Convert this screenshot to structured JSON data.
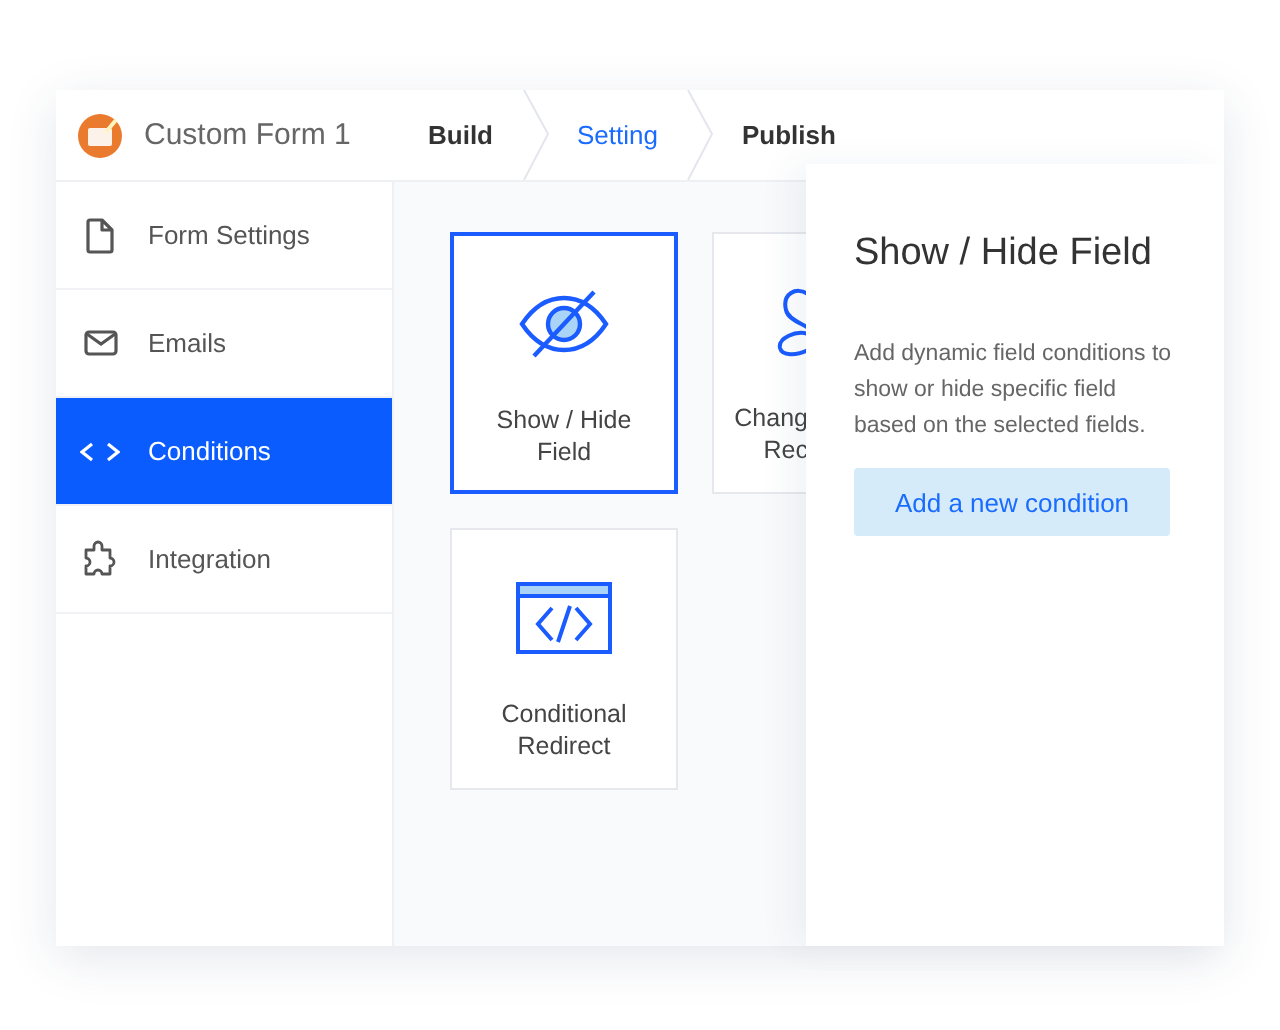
{
  "app": {
    "form_title": "Custom Form 1"
  },
  "steps": [
    {
      "label": "Build",
      "selected": false
    },
    {
      "label": "Setting",
      "selected": true
    },
    {
      "label": "Publish",
      "selected": false
    }
  ],
  "sidebar": {
    "items": [
      {
        "label": "Form Settings",
        "kind": "document",
        "selected": false
      },
      {
        "label": "Emails",
        "kind": "mail",
        "selected": false
      },
      {
        "label": "Conditions",
        "kind": "code",
        "selected": true
      },
      {
        "label": "Integration",
        "kind": "puzzle",
        "selected": false
      }
    ]
  },
  "cards": [
    {
      "lines": [
        "Show / Hide",
        "Field"
      ],
      "kind": "eye-slash",
      "selected": true
    },
    {
      "lines": [
        "Chang",
        "Rec"
      ],
      "kind": "partial",
      "selected": false
    },
    {
      "lines": [
        "Conditional",
        "Redirect"
      ],
      "kind": "code-window",
      "selected": false
    }
  ],
  "panel": {
    "title": "Show / Hide Field",
    "description": "Add dynamic field conditions to show or hide specific field based on the selected fields.",
    "button": "Add a new condition"
  }
}
